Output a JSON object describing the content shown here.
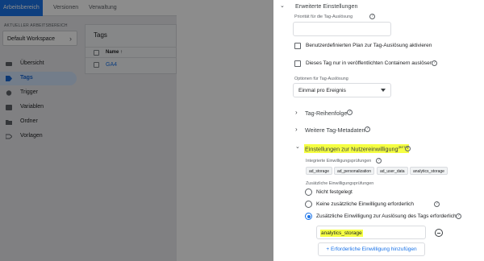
{
  "gtm": {
    "tabs": [
      "Arbeitsbereich",
      "Versionen",
      "Verwaltung"
    ],
    "workspace_label": "AKTUELLER ARBEITSBEREICH",
    "workspace_name": "Default Workspace",
    "nav": [
      {
        "label": "Übersicht",
        "icon": "overview-icon"
      },
      {
        "label": "Tags",
        "icon": "tag-icon",
        "active": true
      },
      {
        "label": "Trigger",
        "icon": "trigger-icon"
      },
      {
        "label": "Variablen",
        "icon": "variables-icon"
      },
      {
        "label": "Ordner",
        "icon": "folder-icon"
      },
      {
        "label": "Vorlagen",
        "icon": "templates-icon"
      }
    ],
    "main_title": "Tags",
    "column_name": "Name ↑",
    "rows": [
      "GA4"
    ]
  },
  "panel": {
    "advanced_title": "Erweiterte Einstellungen",
    "priority_label": "Priorität für die Tag-Auslösung",
    "priority_value": "",
    "custom_schedule_label": "Benutzerdefinierten Plan zur Tag-Auslösung aktivieren",
    "published_only_label": "Dieses Tag nur in veröffentlichten Containern auslösen",
    "firing_options_label": "Optionen für Tag-Auslösung",
    "firing_option_value": "Einmal pro Ereignis",
    "sequencing_title": "Tag-Reihenfolge",
    "metadata_title": "Weitere Tag-Metadaten",
    "consent_title": "Einstellungen zur Nutzereinwilligung",
    "consent_beta": "(BETA)",
    "builtin_label": "Integrierte Einwilligungsprüfungen",
    "builtin_chips": [
      "ad_storage",
      "ad_personalization",
      "ad_user_data",
      "analytics_storage"
    ],
    "additional_label": "Zusätzliche Einwilligungsprüfungen",
    "radio_options": [
      "Nicht festgelegt",
      "Keine zusätzliche Einwilligung erforderlich",
      "Zusätzliche Einwilligung zur Auslösung des Tags erforderlich"
    ],
    "radio_selected_index": 2,
    "consent_type_value": "analytics_storage",
    "add_consent_button": "+ Erforderliche Einwilligung hinzufügen"
  },
  "colors": {
    "accent": "#1a73e8",
    "highlight": "#f5ff43",
    "overlay": "rgba(0,0,0,0.45)"
  }
}
